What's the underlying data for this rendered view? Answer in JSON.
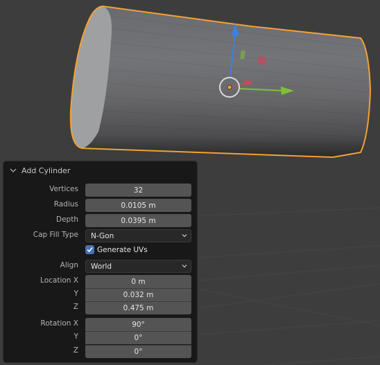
{
  "viewport": {
    "object": "Cylinder",
    "selection_outline_color": "#f4a233",
    "gizmo": {
      "z_axis_color": "#3f7ee8",
      "y_axis_color": "#7cc234",
      "x_axis_color": "#d04a56",
      "origin_color": "#f4a233"
    }
  },
  "panel": {
    "title": "Add Cylinder",
    "fields": {
      "vertices": {
        "label": "Vertices",
        "value": "32"
      },
      "radius": {
        "label": "Radius",
        "value": "0.0105 m"
      },
      "depth": {
        "label": "Depth",
        "value": "0.0395 m"
      },
      "cap_fill_type": {
        "label": "Cap Fill Type",
        "value": "N-Gon"
      },
      "generate_uvs": {
        "label": "Generate UVs",
        "checked": true
      },
      "align": {
        "label": "Align",
        "value": "World"
      },
      "location": {
        "x": {
          "label": "Location X",
          "value": "0 m"
        },
        "y": {
          "label": "Y",
          "value": "0.032 m"
        },
        "z": {
          "label": "Z",
          "value": "0.475 m"
        }
      },
      "rotation": {
        "x": {
          "label": "Rotation X",
          "value": "90°"
        },
        "y": {
          "label": "Y",
          "value": "0°"
        },
        "z": {
          "label": "Z",
          "value": "0°"
        }
      }
    },
    "accent_color": "#4772b3"
  }
}
